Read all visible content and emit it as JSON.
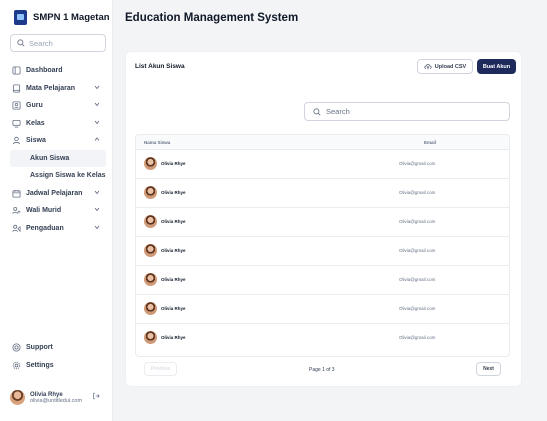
{
  "brand": {
    "name": "SMPN 1 Magetan"
  },
  "app_title": "Education Management System",
  "sidebar": {
    "search_placeholder": "Search",
    "items": [
      {
        "label": "Dashboard",
        "icon": "dashboard-icon",
        "expandable": false
      },
      {
        "label": "Mata Pelajaran",
        "icon": "book-icon",
        "expandable": true
      },
      {
        "label": "Guru",
        "icon": "id-card-icon",
        "expandable": true
      },
      {
        "label": "Kelas",
        "icon": "classroom-icon",
        "expandable": true
      },
      {
        "label": "Siswa",
        "icon": "user-icon",
        "expandable": true,
        "expanded": true,
        "children": [
          {
            "label": "Akun Siswa",
            "active": true
          },
          {
            "label": "Assign Siswa ke Kelas",
            "active": false
          }
        ]
      },
      {
        "label": "Jadwal Pelajaran",
        "icon": "calendar-icon",
        "expandable": true
      },
      {
        "label": "Wali Murid",
        "icon": "users-icon",
        "expandable": true
      },
      {
        "label": "Pengaduan",
        "icon": "megaphone-icon",
        "expandable": true
      }
    ],
    "bottom": [
      {
        "label": "Support",
        "icon": "support-icon"
      },
      {
        "label": "Settings",
        "icon": "gear-icon"
      }
    ],
    "user": {
      "name": "Olivia Rhye",
      "email": "olivia@untitledui.com"
    }
  },
  "card": {
    "title": "List Akun Siswa",
    "upload_label": "Upload CSV",
    "create_label": "Buat Akun",
    "search_placeholder": "Search",
    "columns": [
      "Nama Siswa",
      "Email"
    ],
    "rows": [
      {
        "name": "Olivia Rhye",
        "email": "Olivia@gmail.com"
      },
      {
        "name": "Olivia Rhye",
        "email": "Olivia@gmail.com"
      },
      {
        "name": "Olivia Rhye",
        "email": "Olivia@gmail.com"
      },
      {
        "name": "Olivia Rhye",
        "email": "Olivia@gmail.com"
      },
      {
        "name": "Olivia Rhye",
        "email": "Olivia@gmail.com"
      },
      {
        "name": "Olivia Rhye",
        "email": "Olivia@gmail.com"
      },
      {
        "name": "Olivia Rhye",
        "email": "Olivia@gmail.com"
      }
    ],
    "pagination": {
      "previous": "Previous",
      "info": "Page 1 of 3",
      "next": "Next"
    }
  },
  "colors": {
    "primary": "#1d2a5b",
    "border": "#eaecf0",
    "background": "#f3f4f6"
  }
}
